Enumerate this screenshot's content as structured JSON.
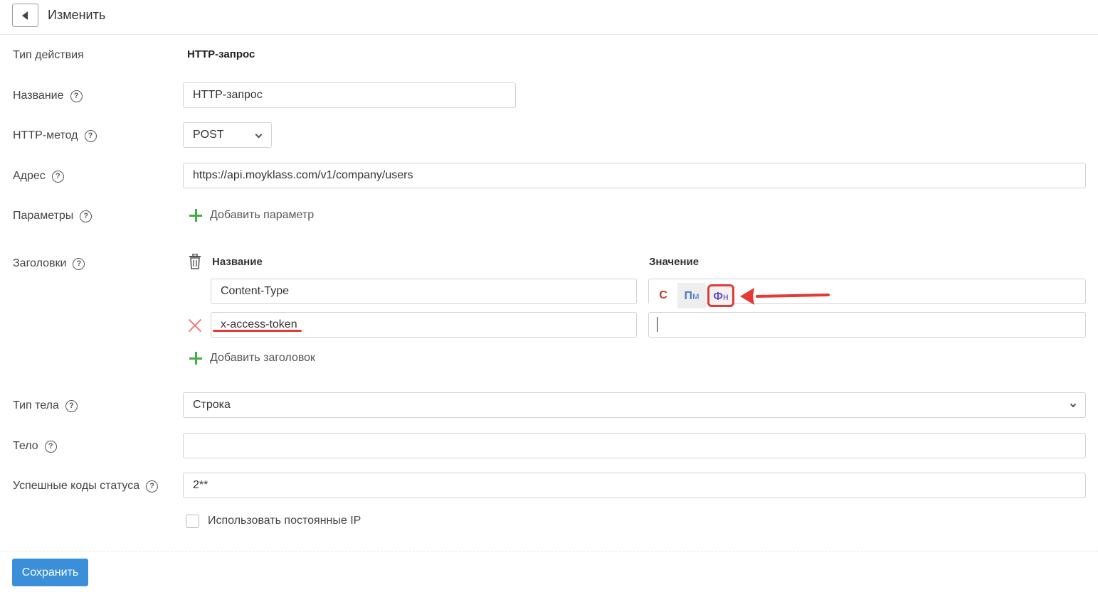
{
  "header": {
    "title": "Изменить"
  },
  "form": {
    "action_type": {
      "label": "Тип действия",
      "value": "HTTP-запрос"
    },
    "name": {
      "label": "Название",
      "value": "HTTP-запрос"
    },
    "http_method": {
      "label": "HTTP-метод",
      "value": "POST"
    },
    "address": {
      "label": "Адрес",
      "value": "https://api.moyklass.com/v1/company/users"
    },
    "params": {
      "label": "Параметры",
      "add_label": "Добавить параметр"
    },
    "headers": {
      "label": "Заголовки",
      "col_name": "Название",
      "col_value": "Значение",
      "rows": [
        {
          "name": "Content-Type",
          "value": ""
        },
        {
          "name": "x-access-token",
          "value": ""
        }
      ],
      "mode_buttons": {
        "c": "С",
        "pm_main": "П",
        "pm_sub": "м",
        "fn_main": "Ф",
        "fn_sub": "н"
      },
      "add_label": "Добавить заголовок"
    },
    "body_type": {
      "label": "Тип тела",
      "value": "Строка"
    },
    "body": {
      "label": "Тело",
      "value": ""
    },
    "status_codes": {
      "label": "Успешные коды статуса",
      "value": "2**"
    },
    "static_ip": {
      "label": "Использовать постоянные IP",
      "checked": false
    }
  },
  "footer": {
    "save_label": "Сохранить"
  },
  "help_mark": "?",
  "colors": {
    "accent": "#3a8fd8",
    "add": "#3cb043",
    "highlight": "#e53935"
  }
}
